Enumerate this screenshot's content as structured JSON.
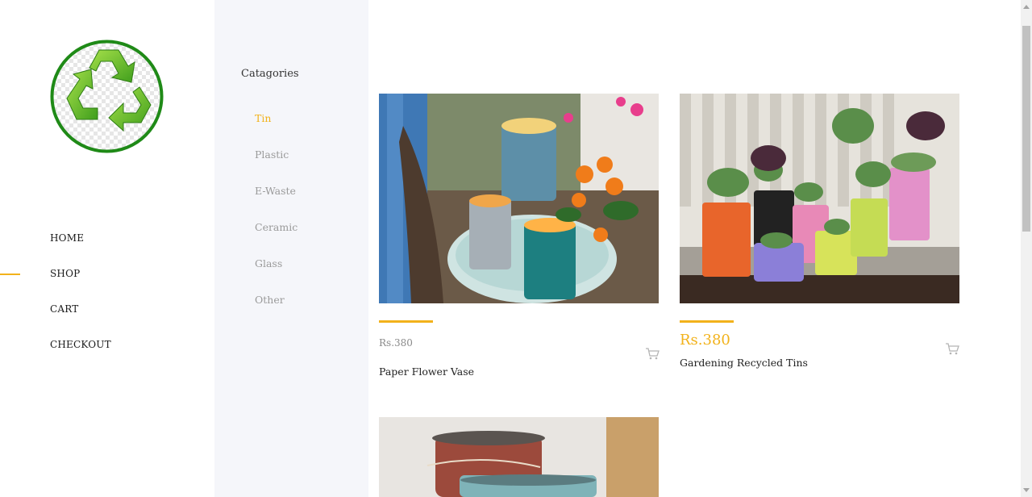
{
  "nav": {
    "items": [
      {
        "label": "HOME",
        "active": false
      },
      {
        "label": "SHOP",
        "active": true
      },
      {
        "label": "CART",
        "active": false
      },
      {
        "label": "CHECKOUT",
        "active": false
      }
    ]
  },
  "categories": {
    "title": "Catagories",
    "items": [
      "Tin",
      "Plastic",
      "E-Waste",
      "Ceramic",
      "Glass",
      "Other"
    ],
    "active": "Tin"
  },
  "products": [
    {
      "price": "Rs.380",
      "name": "Paper Flower Vase"
    },
    {
      "price": "Rs.380",
      "name": "Gardening Recycled Tins"
    }
  ],
  "colors": {
    "accent": "#f2b21b",
    "logo_green": "#2b8a1e",
    "panel_bg": "#f5f6fa"
  },
  "icons": {
    "logo": "recycle-icon",
    "cart": "shopping-cart-icon"
  }
}
